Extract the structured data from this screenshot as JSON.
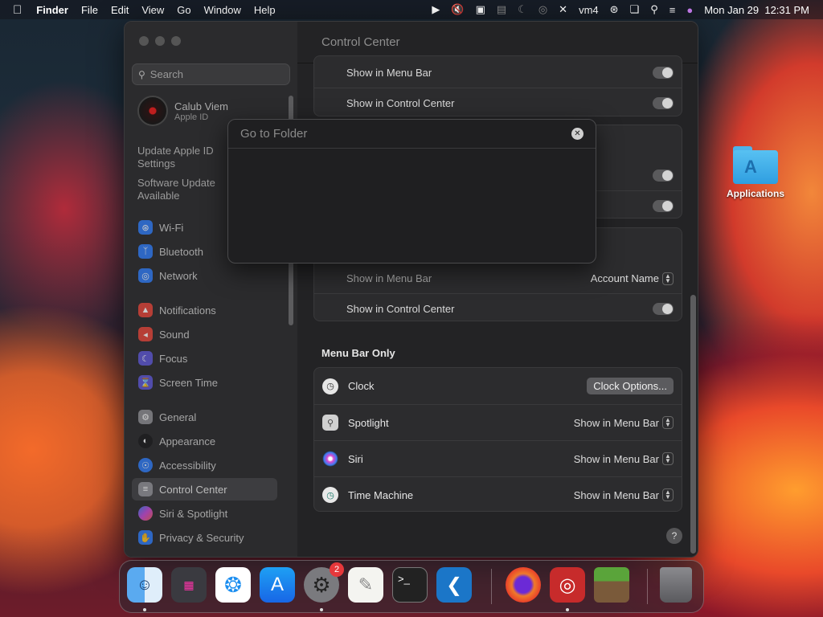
{
  "menubar": {
    "apple": "",
    "app": "Finder",
    "menus": [
      "File",
      "Edit",
      "View",
      "Go",
      "Window",
      "Help"
    ],
    "user": "vm4",
    "datetime": "Mon Jan 29  12:31 PM",
    "status_icons": [
      "play-circle-icon",
      "mute-icon",
      "display-icon",
      "window-icon",
      "moon-icon",
      "airplay-icon",
      "pencil-off-icon",
      "vm-icon",
      "wifi-icon",
      "screen-mirror-icon",
      "search-icon",
      "control-center-icon",
      "siri-icon"
    ]
  },
  "desktop": {
    "applications_label": "Applications"
  },
  "sidebar": {
    "search_placeholder": "Search",
    "account_name": "Calub Viem",
    "account_sub": "Apple ID",
    "notice1": "Update Apple ID Settings",
    "notice2": "Software Update Available",
    "items": [
      {
        "label": "Wi-Fi",
        "color": "#2f7bf5",
        "icon": "wifi-icon"
      },
      {
        "label": "Bluetooth",
        "color": "#2f7bf5",
        "icon": "bluetooth-icon"
      },
      {
        "label": "Network",
        "color": "#2f7bf5",
        "icon": "globe-icon"
      },
      {
        "label": "Notifications",
        "color": "#e5453a",
        "icon": "bell-icon"
      },
      {
        "label": "Sound",
        "color": "#e5453a",
        "icon": "speaker-icon"
      },
      {
        "label": "Focus",
        "color": "#5e58d6",
        "icon": "moon-icon"
      },
      {
        "label": "Screen Time",
        "color": "#5e58d6",
        "icon": "hourglass-icon"
      },
      {
        "label": "General",
        "color": "#8e8e93",
        "icon": "gear-icon"
      },
      {
        "label": "Appearance",
        "color": "#1c1c1e",
        "icon": "appearance-icon"
      },
      {
        "label": "Accessibility",
        "color": "#2f7bf5",
        "icon": "accessibility-icon"
      },
      {
        "label": "Control Center",
        "color": "#8e8e93",
        "icon": "control-center-icon"
      },
      {
        "label": "Siri & Spotlight",
        "color": "#b44cd3",
        "icon": "siri-icon"
      },
      {
        "label": "Privacy & Security",
        "color": "#2f7bf5",
        "icon": "hand-icon"
      }
    ]
  },
  "main": {
    "title": "Control Center",
    "show_in_menu_bar": "Show in Menu Bar",
    "show_in_control_center": "Show in Control Center",
    "account_name_option": "Account Name",
    "menu_bar_only": "Menu Bar Only",
    "clock": "Clock",
    "clock_options": "Clock Options...",
    "spotlight": "Spotlight",
    "siri": "Siri",
    "time_machine": "Time Machine",
    "help": "?"
  },
  "dialog": {
    "title": "Go to Folder"
  },
  "dock": {
    "badge": "2"
  }
}
